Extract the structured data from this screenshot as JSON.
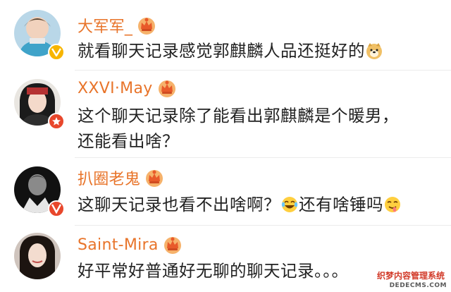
{
  "comments": [
    {
      "username": "大军军_",
      "text_before": "就看聊天记录感觉郭麒麟人品还挺好的",
      "text_after": "",
      "badge": "vip-crown-icon",
      "verified": "yellow"
    },
    {
      "username": "XXVI·May",
      "line1": "这个聊天记录除了能看出郭麒麟是个暖男，",
      "line2": "还能看出啥？",
      "badge": "vip-crown-icon",
      "verified": "red"
    },
    {
      "username": "扒圈老鬼",
      "text_a": "这聊天记录也看不出啥啊？",
      "text_b": "还有啥锤吗",
      "badge": "vip-crown-icon",
      "verified": "red"
    },
    {
      "username": "Saint-Mira",
      "text": "好平常好普通好无聊的聊天记录。。。",
      "badge": "vip-crown-icon"
    }
  ],
  "watermark": {
    "line1": "织梦内容管理系统",
    "line2": "DEDECMS.COM"
  },
  "colors": {
    "username": "#e8742a",
    "text": "#222222",
    "verified_yellow": "#f7b500",
    "verified_red": "#e8472c"
  }
}
